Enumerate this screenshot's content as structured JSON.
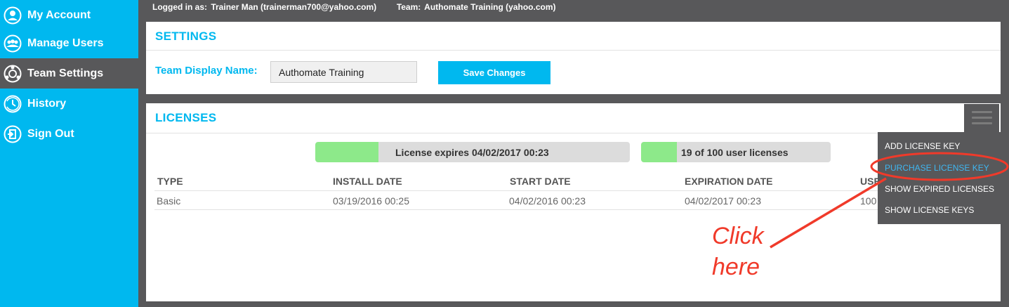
{
  "sidebar": {
    "items": [
      {
        "label": "My Account",
        "icon": "user-icon"
      },
      {
        "label": "Manage Users",
        "icon": "users-icon"
      },
      {
        "label": "Team Settings",
        "icon": "team-settings-icon",
        "active": true
      },
      {
        "label": "History",
        "icon": "history-icon"
      },
      {
        "label": "Sign Out",
        "icon": "sign-out-icon"
      }
    ]
  },
  "topbar": {
    "logged_in_label": "Logged in as:",
    "logged_in_value": "Trainer Man (trainerman700@yahoo.com)",
    "team_label": "Team:",
    "team_value": "Authomate Training (yahoo.com)"
  },
  "settings": {
    "title": "SETTINGS",
    "display_name_label": "Team Display Name:",
    "display_name_value": "Authomate Training",
    "save_label": "Save Changes"
  },
  "licenses": {
    "title": "LICENSES",
    "expiry_bar": {
      "text": "License expires 04/02/2017 00:23",
      "fill_fraction": 0.2
    },
    "usage_bar": {
      "text": "19 of 100 user licenses",
      "fill_fraction": 0.19
    },
    "columns": [
      "TYPE",
      "INSTALL DATE",
      "START DATE",
      "EXPIRATION DATE",
      "USE"
    ],
    "rows": [
      [
        "Basic",
        "03/19/2016 00:25",
        "04/02/2016 00:23",
        "04/02/2017 00:23",
        "100"
      ]
    ]
  },
  "menu": {
    "items": [
      "ADD LICENSE KEY",
      "PURCHASE LICENSE KEY",
      "SHOW EXPIRED LICENSES",
      "SHOW LICENSE KEYS"
    ],
    "highlighted_index": 1
  },
  "annotation": {
    "line1": "Click",
    "line2": "here",
    "color": "#f03a2a"
  },
  "colors": {
    "accent": "#00b8ef",
    "sidebar_active": "#58585a",
    "progress_fill": "#8de98a"
  }
}
